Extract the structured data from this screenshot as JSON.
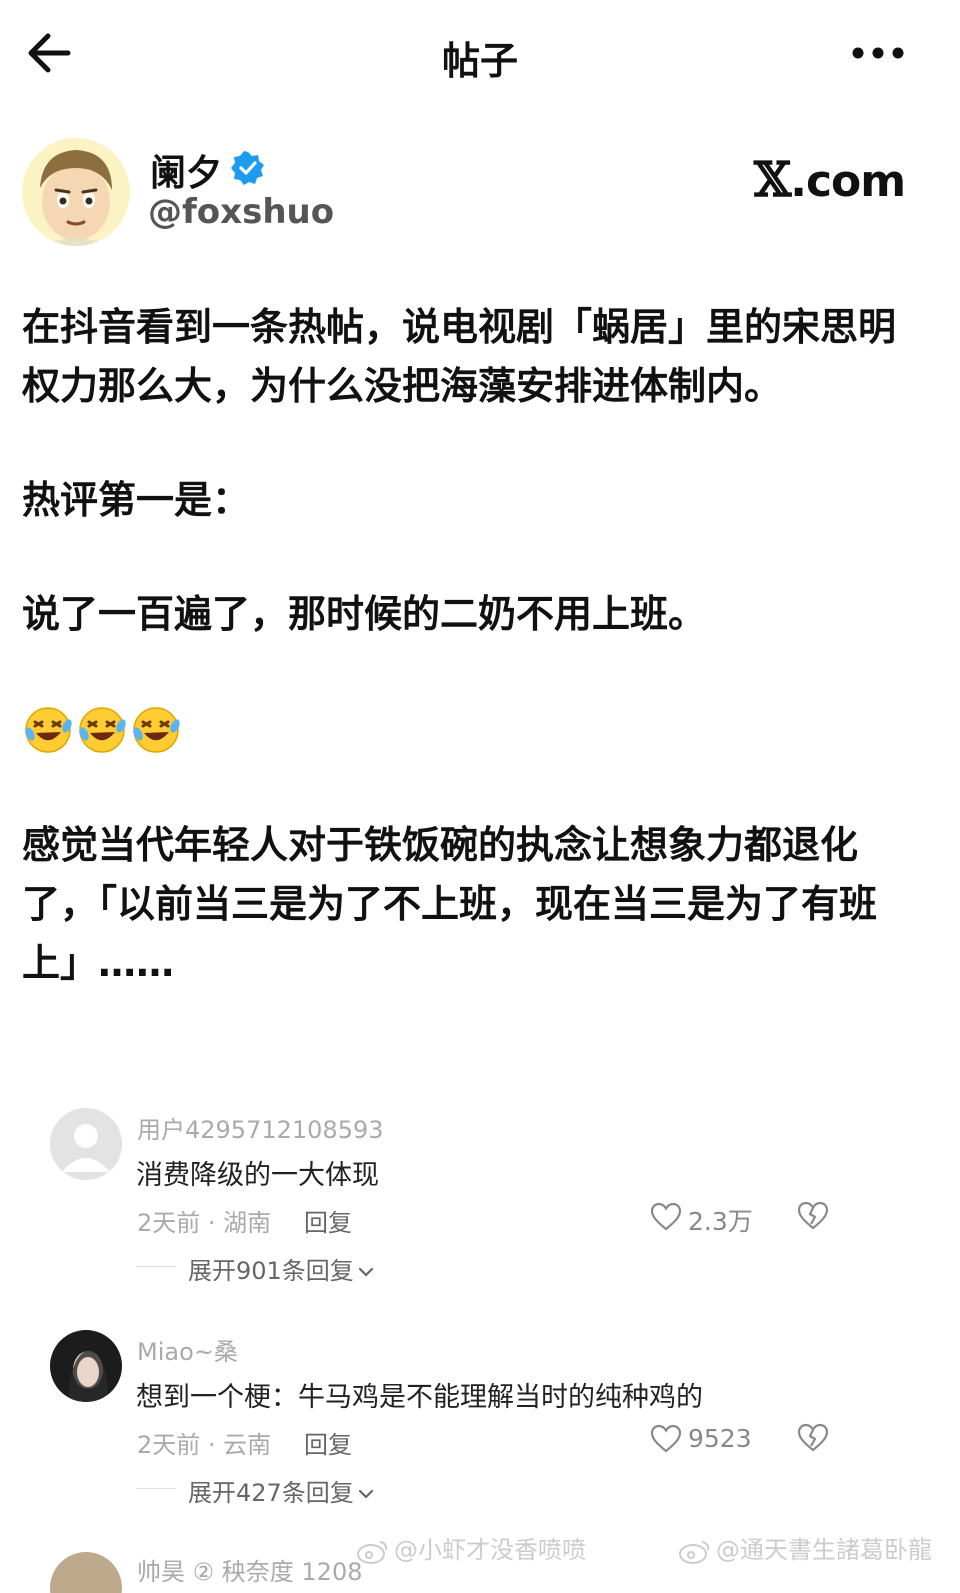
{
  "header": {
    "title": "帖子",
    "back_icon": "arrow-left-icon",
    "more_icon": "more-horizontal-icon"
  },
  "author": {
    "name": "阑夕",
    "handle": "@foxshuo",
    "verified_icon": "verified-badge-icon",
    "brand": "X.com",
    "brand_mark": "𝕏",
    "brand_rest": ".com"
  },
  "post": {
    "paragraph_1": "在抖音看到一条热帖，说电视剧「蜗居」里的宋思明权力那么大，为什么没把海藻安排进体制内。",
    "paragraph_2": "热评第一是：",
    "paragraph_3": "说了一百遍了，那时候的二奶不用上班。",
    "emojis": [
      "rolling-on-floor-laughing-emoji",
      "rolling-on-floor-laughing-emoji",
      "rolling-on-floor-laughing-emoji"
    ],
    "paragraph_4": "感觉当代年轻人对于铁饭碗的执念让想象力都退化了，「以前当三是为了不上班，现在当三是为了有班上」……"
  },
  "comments": [
    {
      "user": "用户4295712108593",
      "text": "消费降级的一大体现",
      "meta": "2天前 · 湖南",
      "reply_label": "回复",
      "likes": "2.3万",
      "expand_label": "展开901条回复"
    },
    {
      "user": "Miao~桑",
      "text": "想到一个梗：牛马鸡是不能理解当时的纯种鸡的",
      "meta": "2天前 · 云南",
      "reply_label": "回复",
      "likes": "9523",
      "expand_label": "展开427条回复"
    }
  ],
  "partial_comment": {
    "user": "帅昊 ② 秧奈度 1208"
  },
  "watermarks": {
    "left": "@小虾才没香喷喷",
    "right": "@通天書生諸葛卧龍"
  },
  "colors": {
    "verified": "#1d9bf0",
    "muted_text": "#aaaaaa",
    "body_text": "#111111"
  }
}
